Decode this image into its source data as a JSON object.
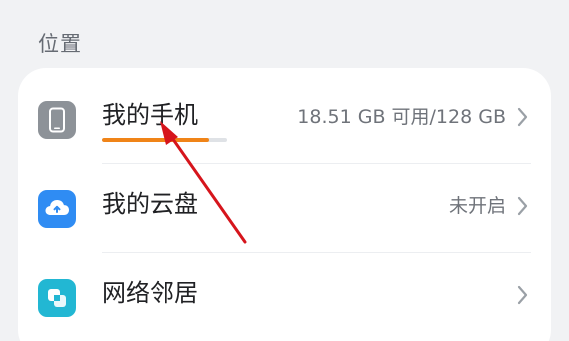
{
  "section": {
    "title": "位置"
  },
  "locations": [
    {
      "label": "我的手机",
      "value": "18.51 GB 可用/128 GB",
      "icon": "phone-icon",
      "storage_used_fraction": 0.855
    },
    {
      "label": "我的云盘",
      "value": "未开启",
      "icon": "cloud-icon"
    },
    {
      "label": "网络邻居",
      "value": "",
      "icon": "network-neighborhood-icon"
    }
  ],
  "colors": {
    "background": "#f1f2f4",
    "card": "#ffffff",
    "phone_icon": "#8d9298",
    "cloud_icon": "#2f8cf3",
    "nearby_icon": "#22b7d3",
    "storage_bar": "#f08418",
    "annotation_arrow": "#d6151c"
  }
}
